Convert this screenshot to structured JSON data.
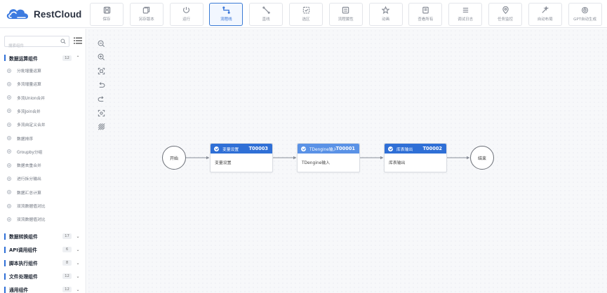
{
  "app": {
    "logo_text": "RestCloud",
    "brand_color": "#2f6fd6"
  },
  "toolbar": [
    {
      "label": "保存",
      "icon": "save-icon"
    },
    {
      "label": "另存版本",
      "icon": "save-version-icon"
    },
    {
      "label": "运行",
      "icon": "run-icon"
    },
    {
      "label": "流程线",
      "icon": "flow-line-icon",
      "active": true
    },
    {
      "label": "直线",
      "icon": "straight-line-icon"
    },
    {
      "label": "选区",
      "icon": "selection-icon"
    },
    {
      "label": "流程属性",
      "icon": "process-properties-icon"
    },
    {
      "label": "动画",
      "icon": "animation-icon"
    },
    {
      "label": "查看所有",
      "icon": "view-all-icon"
    },
    {
      "label": "调试日志",
      "icon": "debug-log-icon"
    },
    {
      "label": "任务监控",
      "icon": "task-monitor-icon"
    },
    {
      "label": "自动布局",
      "icon": "auto-layout-icon"
    },
    {
      "label": "GPT自动生成",
      "icon": "gpt-generate-icon"
    }
  ],
  "sidebar": {
    "search_placeholder": "搜索组件",
    "groups": [
      {
        "name": "数据运算组件",
        "count": "12",
        "expanded": true,
        "items": [
          "分批增量运算",
          "多流增量运算",
          "多流Union合并",
          "多流Join合并",
          "多流自定义合并",
          "数据排序",
          "Groupby分组",
          "数据去重合并",
          "进行拆分输出",
          "数据汇总计算",
          "双流数据值对比",
          "双流数据值对比"
        ]
      },
      {
        "name": "数据转换组件",
        "count": "17",
        "expanded": false
      },
      {
        "name": "API调用组件",
        "count": "6",
        "expanded": false
      },
      {
        "name": "脚本执行组件",
        "count": "8",
        "expanded": false
      },
      {
        "name": "文件处理组件",
        "count": "12",
        "expanded": false
      },
      {
        "name": "通用组件",
        "count": "12",
        "expanded": false
      }
    ]
  },
  "canvas_tools": [
    {
      "icon": "zoom-out-icon"
    },
    {
      "icon": "zoom-in-icon"
    },
    {
      "icon": "fit-view-icon"
    },
    {
      "icon": "undo-icon"
    },
    {
      "icon": "redo-icon"
    },
    {
      "icon": "actual-size-icon"
    },
    {
      "icon": "grid-toggle-icon"
    }
  ],
  "flow": {
    "start_label": "开始",
    "end_label": "结束",
    "nodes": [
      {
        "title": "变量设置",
        "code": "T00003",
        "body": "变量设置",
        "header_color": "#2f6fd6"
      },
      {
        "title": "TDengine输入",
        "code": "T00001",
        "body": "TDengine输入",
        "header_color": "#5a92e6"
      },
      {
        "title": "库表输出",
        "code": "T00002",
        "body": "库表输出",
        "header_color": "#2f6fd6"
      }
    ]
  }
}
